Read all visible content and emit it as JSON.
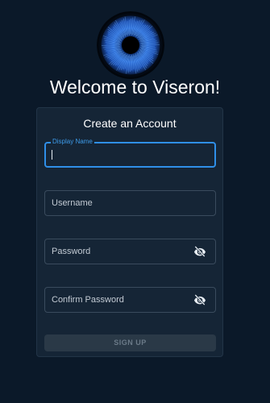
{
  "header": {
    "welcome_text": "Welcome to Viseron!"
  },
  "form": {
    "title": "Create an Account",
    "display_name": {
      "label": "Display Name",
      "value": ""
    },
    "username": {
      "label": "Username",
      "value": ""
    },
    "password": {
      "label": "Password",
      "value": "",
      "toggle_icon": "visibility-off-icon"
    },
    "confirm_password": {
      "label": "Confirm Password",
      "value": "",
      "toggle_icon": "visibility-off-icon"
    },
    "submit_label": "SIGN UP",
    "submit_disabled": true
  },
  "colors": {
    "background": "#0b1929",
    "card": "#152536",
    "focus_accent": "#2f8fe8",
    "disabled_button": "#2a3947"
  }
}
